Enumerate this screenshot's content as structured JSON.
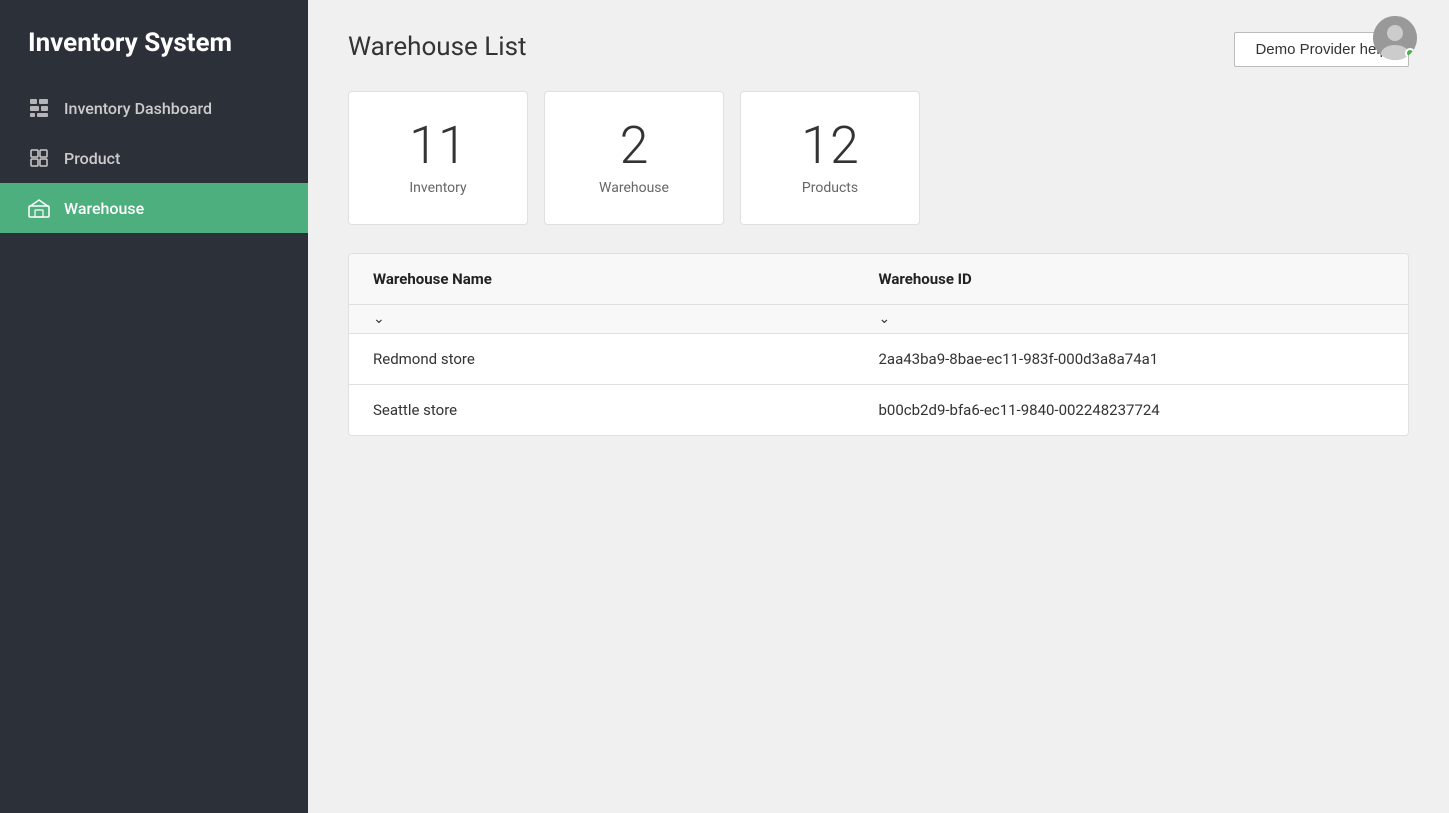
{
  "app": {
    "title": "Inventory System"
  },
  "sidebar": {
    "items": [
      {
        "id": "inventory-dashboard",
        "label": "Inventory Dashboard",
        "icon": "dashboard-icon",
        "active": false
      },
      {
        "id": "product",
        "label": "Product",
        "icon": "product-icon",
        "active": false
      },
      {
        "id": "warehouse",
        "label": "Warehouse",
        "icon": "warehouse-icon",
        "active": true
      }
    ]
  },
  "header": {
    "demo_button_label": "Demo Provider help"
  },
  "page": {
    "title": "Warehouse List"
  },
  "stats": [
    {
      "number": "11",
      "label": "Inventory"
    },
    {
      "number": "2",
      "label": "Warehouse"
    },
    {
      "number": "12",
      "label": "Products"
    }
  ],
  "table": {
    "columns": [
      {
        "id": "name",
        "label": "Warehouse Name"
      },
      {
        "id": "id",
        "label": "Warehouse ID"
      }
    ],
    "rows": [
      {
        "name": "Redmond store",
        "warehouse_id": "2aa43ba9-8bae-ec11-983f-000d3a8a74a1"
      },
      {
        "name": "Seattle store",
        "warehouse_id": "b00cb2d9-bfa6-ec11-9840-002248237724"
      }
    ]
  }
}
